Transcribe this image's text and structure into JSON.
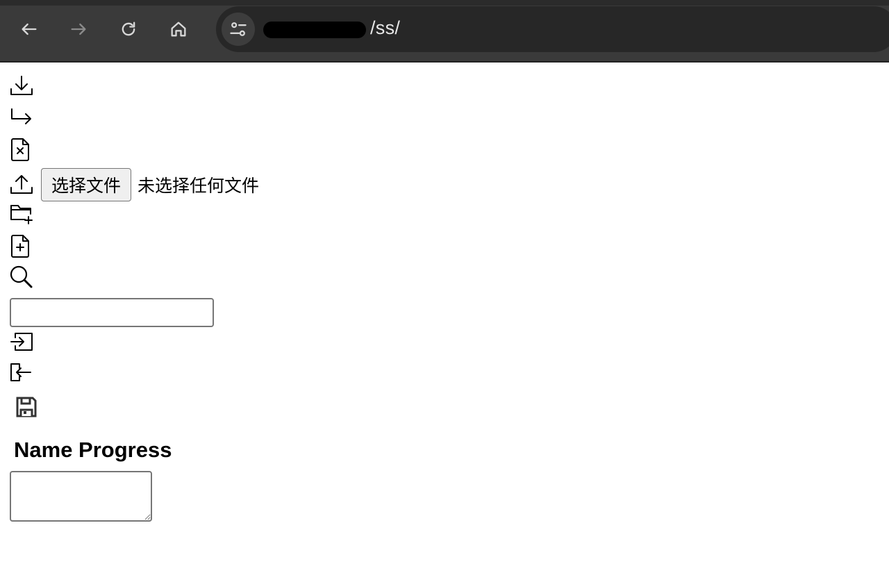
{
  "browser": {
    "url_suffix": "/ss/",
    "icons": [
      "back-arrow-icon",
      "forward-arrow-icon",
      "reload-icon",
      "home-icon",
      "site-settings-icon"
    ]
  },
  "toolbar_icons": [
    "download-icon",
    "move-arrow-icon",
    "delete-file-icon",
    "upload-icon",
    "new-folder-icon",
    "new-file-icon",
    "search-icon",
    "login-icon",
    "logout-icon",
    "save-icon"
  ],
  "upload": {
    "button_label": "选择文件",
    "status_text": "未选择任何文件"
  },
  "search": {
    "value": "",
    "placeholder": ""
  },
  "progress_section": {
    "heading": "Name Progress",
    "textarea_value": ""
  },
  "colors": {
    "chrome_bg": "#3a3a3a",
    "address_bg": "#272727",
    "icon_stroke": "#000000"
  }
}
